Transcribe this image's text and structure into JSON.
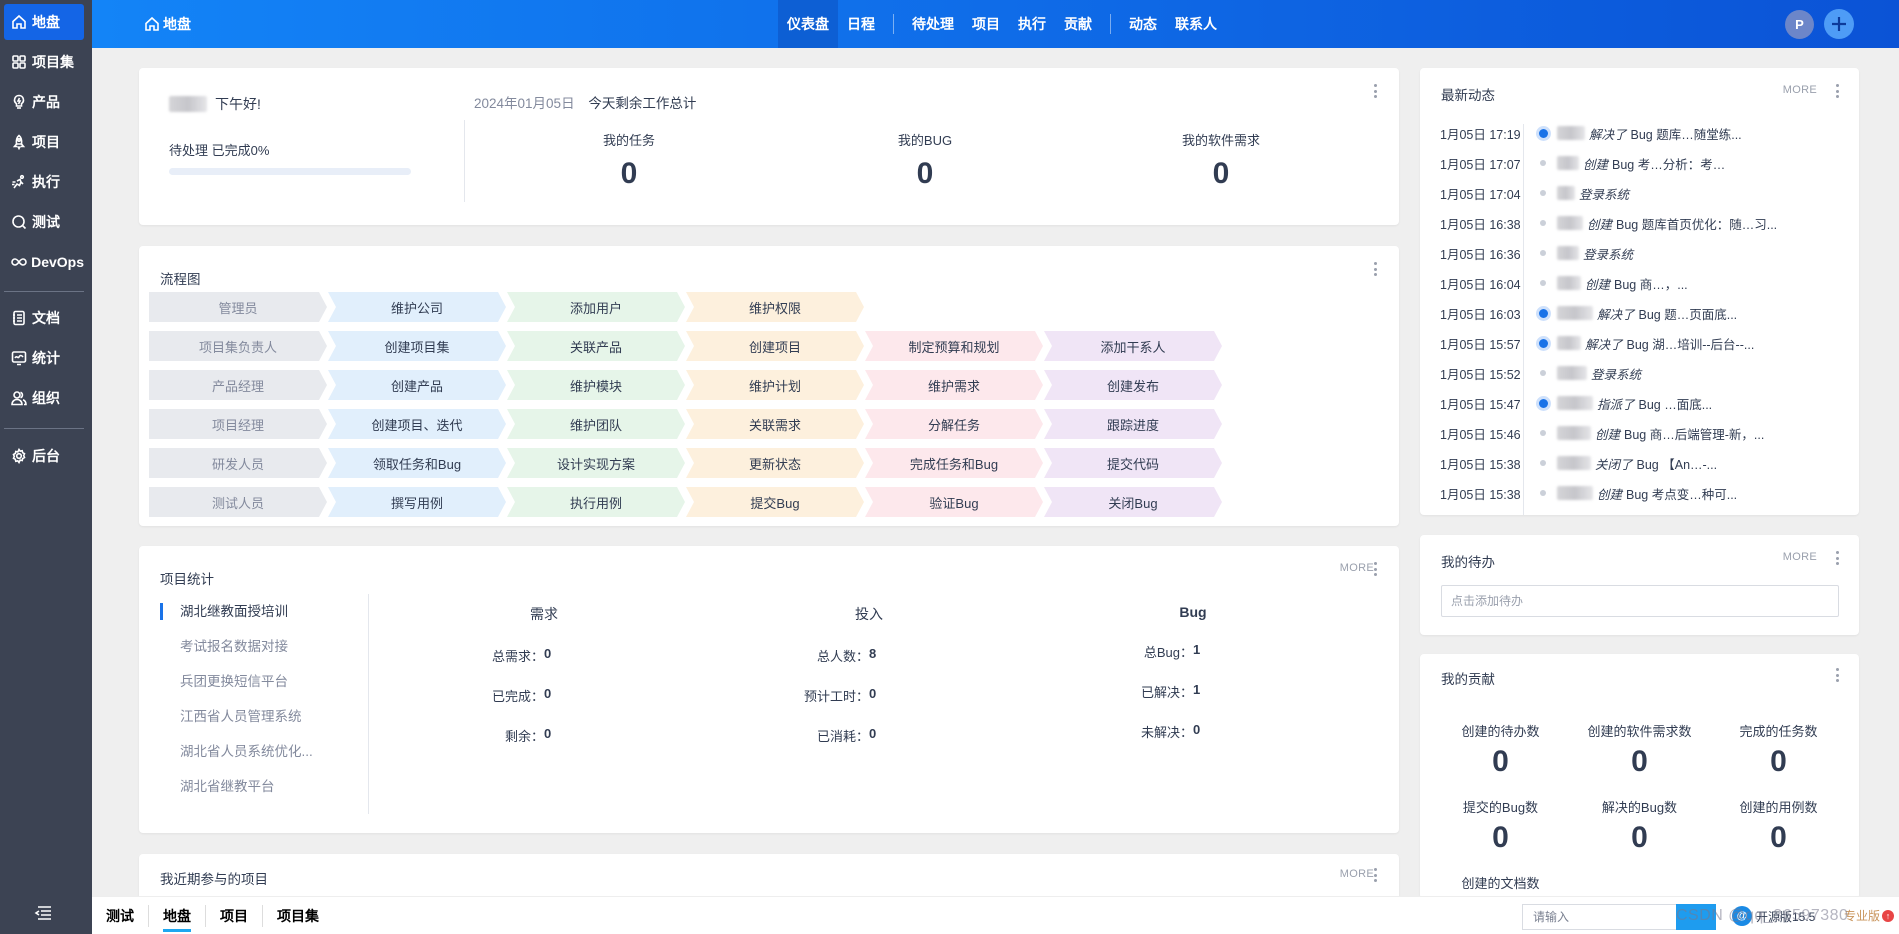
{
  "sidebar": {
    "items": [
      {
        "label": "地盘",
        "icon": "home-icon",
        "active": true
      },
      {
        "label": "项目集",
        "icon": "grid-icon"
      },
      {
        "label": "产品",
        "icon": "lightbulb-icon"
      },
      {
        "label": "项目",
        "icon": "rocket-icon"
      },
      {
        "label": "执行",
        "icon": "run-icon"
      },
      {
        "label": "测试",
        "icon": "search-check-icon"
      },
      {
        "label": "DevOps",
        "icon": "infinity-icon"
      },
      {
        "label": "文档",
        "icon": "document-icon"
      },
      {
        "label": "统计",
        "icon": "monitor-chart-icon"
      },
      {
        "label": "组织",
        "icon": "users-icon"
      },
      {
        "label": "后台",
        "icon": "gear-icon"
      }
    ],
    "collapse_icon": "collapse-menu-icon"
  },
  "topbar": {
    "home_label": "地盘",
    "nav": [
      {
        "label": "仪表盘",
        "active": true
      },
      {
        "label": "日程"
      },
      {
        "label": "待处理"
      },
      {
        "label": "项目"
      },
      {
        "label": "执行"
      },
      {
        "label": "贡献"
      },
      {
        "label": "动态"
      },
      {
        "label": "联系人"
      }
    ],
    "avatar_initial": "P",
    "add_icon": "plus-icon"
  },
  "welcome": {
    "greeting": "下午好!",
    "pending_label": "待处理 已完成0%",
    "progress_percent": 0,
    "date": "2024年01月05日",
    "summary_title": "今天剩余工作总计",
    "stats": [
      {
        "label": "我的任务",
        "value": "0"
      },
      {
        "label": "我的BUG",
        "value": "0"
      },
      {
        "label": "我的软件需求",
        "value": "0"
      }
    ]
  },
  "flow": {
    "title": "流程图",
    "rows": [
      [
        "管理员",
        "维护公司",
        "添加用户",
        "维护权限"
      ],
      [
        "项目集负责人",
        "创建项目集",
        "关联产品",
        "创建项目",
        "制定预算和规划",
        "添加干系人"
      ],
      [
        "产品经理",
        "创建产品",
        "维护模块",
        "维护计划",
        "维护需求",
        "创建发布"
      ],
      [
        "项目经理",
        "创建项目、迭代",
        "维护团队",
        "关联需求",
        "分解任务",
        "跟踪进度"
      ],
      [
        "研发人员",
        "领取任务和Bug",
        "设计实现方案",
        "更新状态",
        "完成任务和Bug",
        "提交代码"
      ],
      [
        "测试人员",
        "撰写用例",
        "执行用例",
        "提交Bug",
        "验证Bug",
        "关闭Bug"
      ]
    ],
    "colors": [
      "#e8eaee",
      "#e1effc",
      "#e6f5e9",
      "#fdf0dd",
      "#fde8ec",
      "#f0e5f6"
    ]
  },
  "project_stats": {
    "title": "项目统计",
    "more": "MORE",
    "projects": [
      {
        "name": "湖北继教面授培训",
        "active": true
      },
      {
        "name": "考试报名数据对接"
      },
      {
        "name": "兵团更换短信平台"
      },
      {
        "name": "江西省人员管理系统"
      },
      {
        "name": "湖北省人员系统优化..."
      },
      {
        "name": "湖北省继教平台"
      }
    ],
    "columns": [
      {
        "title": "需求",
        "rows": [
          {
            "k": "总需求：",
            "v": "0"
          },
          {
            "k": "已完成：",
            "v": "0"
          },
          {
            "k": "剩余：",
            "v": "0"
          }
        ]
      },
      {
        "title": "投入",
        "rows": [
          {
            "k": "总人数：",
            "v": "8"
          },
          {
            "k": "预计工时：",
            "v": "0"
          },
          {
            "k": "已消耗：",
            "v": "0"
          }
        ]
      },
      {
        "title": "Bug",
        "rows": [
          {
            "k": "总Bug：",
            "v": "1"
          },
          {
            "k": "已解决：",
            "v": "1"
          },
          {
            "k": "未解决：",
            "v": "0"
          }
        ]
      }
    ]
  },
  "recent_projects": {
    "title": "我近期参与的项目",
    "more": "MORE"
  },
  "activity": {
    "title": "最新动态",
    "more": "MORE",
    "items": [
      {
        "time": "1月05日 17:19",
        "highlight": true,
        "verb": "解决了",
        "obj": "Bug 题库…随堂练..."
      },
      {
        "time": "1月05日 17:07",
        "highlight": false,
        "verb": "创建",
        "obj": "Bug 考…分析：考…"
      },
      {
        "time": "1月05日 17:04",
        "highlight": false,
        "verb": "登录系统",
        "obj": ""
      },
      {
        "time": "1月05日 16:38",
        "highlight": false,
        "verb": "创建",
        "obj": "Bug 题库首页优化：随…习..."
      },
      {
        "time": "1月05日 16:36",
        "highlight": false,
        "verb": "登录系统",
        "obj": ""
      },
      {
        "time": "1月05日 16:04",
        "highlight": false,
        "verb": "创建",
        "obj": "Bug 商…，..."
      },
      {
        "time": "1月05日 16:03",
        "highlight": true,
        "verb": "解决了",
        "obj": "Bug 题…页面底..."
      },
      {
        "time": "1月05日 15:57",
        "highlight": true,
        "verb": "解决了",
        "obj": "Bug 湖…培训--后台--..."
      },
      {
        "time": "1月05日 15:52",
        "highlight": false,
        "verb": "登录系统",
        "obj": ""
      },
      {
        "time": "1月05日 15:47",
        "highlight": true,
        "verb": "指派了",
        "obj": "Bug …面底..."
      },
      {
        "time": "1月05日 15:46",
        "highlight": false,
        "verb": "创建",
        "obj": "Bug 商…后端管理-新，..."
      },
      {
        "time": "1月05日 15:38",
        "highlight": false,
        "verb": "关闭了",
        "obj": "Bug 【An…-..."
      },
      {
        "time": "1月05日 15:38",
        "highlight": false,
        "verb": "创建",
        "obj": "Bug 考点变…种可..."
      }
    ]
  },
  "todo": {
    "title": "我的待办",
    "more": "MORE",
    "placeholder": "点击添加待办"
  },
  "contribution": {
    "title": "我的贡献",
    "stats": [
      {
        "label": "创建的待办数",
        "value": "0"
      },
      {
        "label": "创建的软件需求数",
        "value": "0"
      },
      {
        "label": "完成的任务数",
        "value": "0"
      },
      {
        "label": "提交的Bug数",
        "value": "0"
      },
      {
        "label": "解决的Bug数",
        "value": "0"
      },
      {
        "label": "创建的用例数",
        "value": "0"
      },
      {
        "label": "创建的文档数",
        "value": ""
      }
    ]
  },
  "bottombar": {
    "tabs": [
      {
        "label": "测试"
      },
      {
        "label": "地盘",
        "active": true
      },
      {
        "label": "项目"
      },
      {
        "label": "项目集"
      }
    ],
    "search_placeholder": "请输入",
    "version": "开源版15.5",
    "upgrade": "专业版",
    "watermark": "CSDN @qq_36597380"
  }
}
